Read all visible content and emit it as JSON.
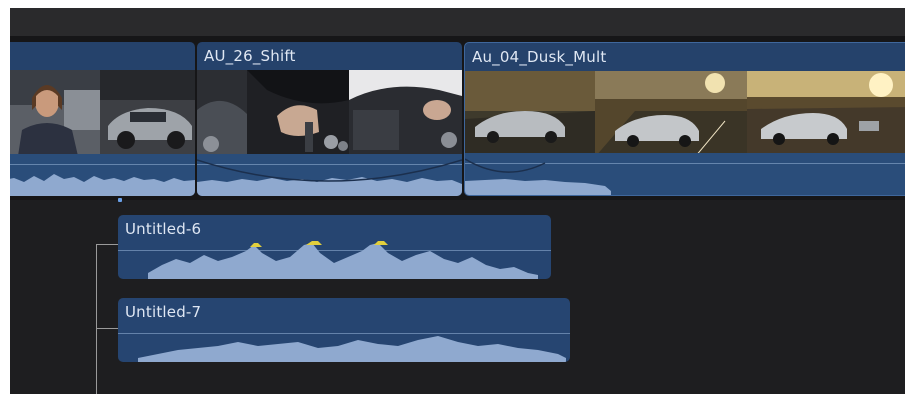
{
  "timeline": {
    "primary_clips": [
      {
        "title": ""
      },
      {
        "title": "AU_26_Shift"
      },
      {
        "title": "Au_04_Dusk_Mult"
      }
    ],
    "connected_clips": [
      {
        "title": "Untitled-6"
      },
      {
        "title": "Untitled-7"
      }
    ]
  },
  "colors": {
    "clip_blue": "#25426b",
    "waveform": "#8fa9cf",
    "peak_warning": "#e2cf3c",
    "background": "#1e1e20"
  }
}
